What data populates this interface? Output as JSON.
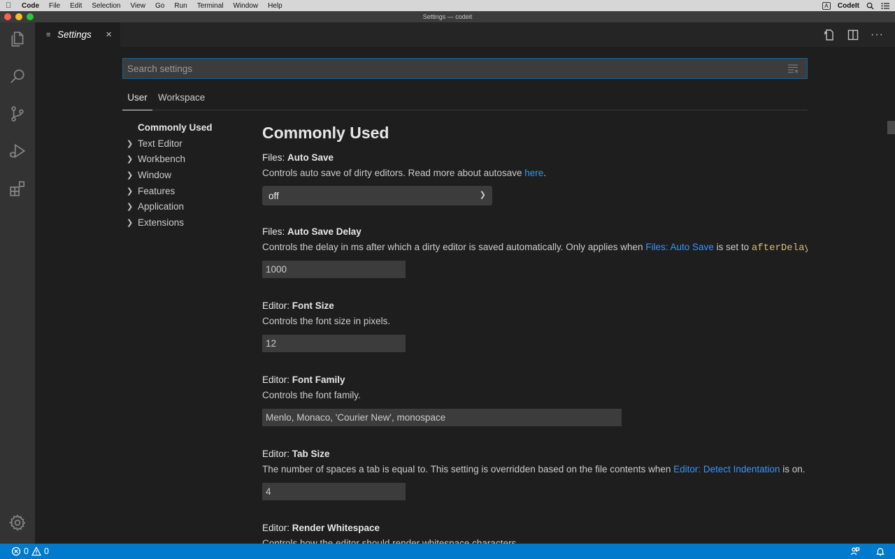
{
  "menubar": {
    "app_name": "Code",
    "items": [
      "File",
      "Edit",
      "Selection",
      "View",
      "Go",
      "Run",
      "Terminal",
      "Window",
      "Help"
    ],
    "input_source": "A",
    "right_app": "CodeIt"
  },
  "window": {
    "title": "Settings — codeit",
    "traffic_colors": [
      "#fe5f57",
      "#febc2e",
      "#28c840"
    ]
  },
  "activity_bar": {
    "icons": [
      "files-icon",
      "search-icon",
      "source-control-icon",
      "run-debug-icon",
      "extensions-icon",
      "gear-icon"
    ]
  },
  "tab": {
    "label": "Settings",
    "close_glyph": "×"
  },
  "editor_actions": [
    "open-settings-json-icon",
    "split-editor-icon",
    "more-actions-icon"
  ],
  "search": {
    "placeholder": "Search settings",
    "value": ""
  },
  "scopes": {
    "user": "User",
    "workspace": "Workspace"
  },
  "toc": {
    "items": [
      {
        "label": "Commonly Used",
        "expandable": false,
        "selected": true
      },
      {
        "label": "Text Editor",
        "expandable": true
      },
      {
        "label": "Workbench",
        "expandable": true
      },
      {
        "label": "Window",
        "expandable": true
      },
      {
        "label": "Features",
        "expandable": true
      },
      {
        "label": "Application",
        "expandable": true
      },
      {
        "label": "Extensions",
        "expandable": true
      }
    ]
  },
  "content": {
    "section_title": "Commonly Used",
    "settings": [
      {
        "category": "Files: ",
        "name": "Auto Save",
        "desc_before": "Controls auto save of dirty editors. Read more about autosave ",
        "desc_link": "here",
        "desc_after": ".",
        "control": "select",
        "value": "off"
      },
      {
        "category": "Files: ",
        "name": "Auto Save Delay",
        "desc_before": "Controls the delay in ms after which a dirty editor is saved automatically. Only applies when ",
        "desc_link": "Files: Auto Save",
        "desc_middle": " is set to ",
        "desc_code": "afterDelay",
        "desc_after": ".",
        "control": "input",
        "value": "1000"
      },
      {
        "category": "Editor: ",
        "name": "Font Size",
        "desc_before": "Controls the font size in pixels.",
        "control": "input",
        "value": "12"
      },
      {
        "category": "Editor: ",
        "name": "Font Family",
        "desc_before": "Controls the font family.",
        "control": "input",
        "value": "Menlo, Monaco, 'Courier New', monospace"
      },
      {
        "category": "Editor: ",
        "name": "Tab Size",
        "desc_before": "The number of spaces a tab is equal to. This setting is overridden based on the file contents when ",
        "desc_link": "Editor: Detect Indentation",
        "desc_after": " is on.",
        "control": "input",
        "value": "4"
      },
      {
        "category": "Editor: ",
        "name": "Render Whitespace",
        "desc_before": "Controls how the editor should render whitespace characters."
      }
    ]
  },
  "statusbar": {
    "errors": "0",
    "warnings": "0",
    "right_icons": [
      "feedback-icon",
      "bell-icon"
    ]
  },
  "colors": {
    "accent": "#007acc",
    "link": "#3794ff",
    "code": "#d7ba7d"
  }
}
